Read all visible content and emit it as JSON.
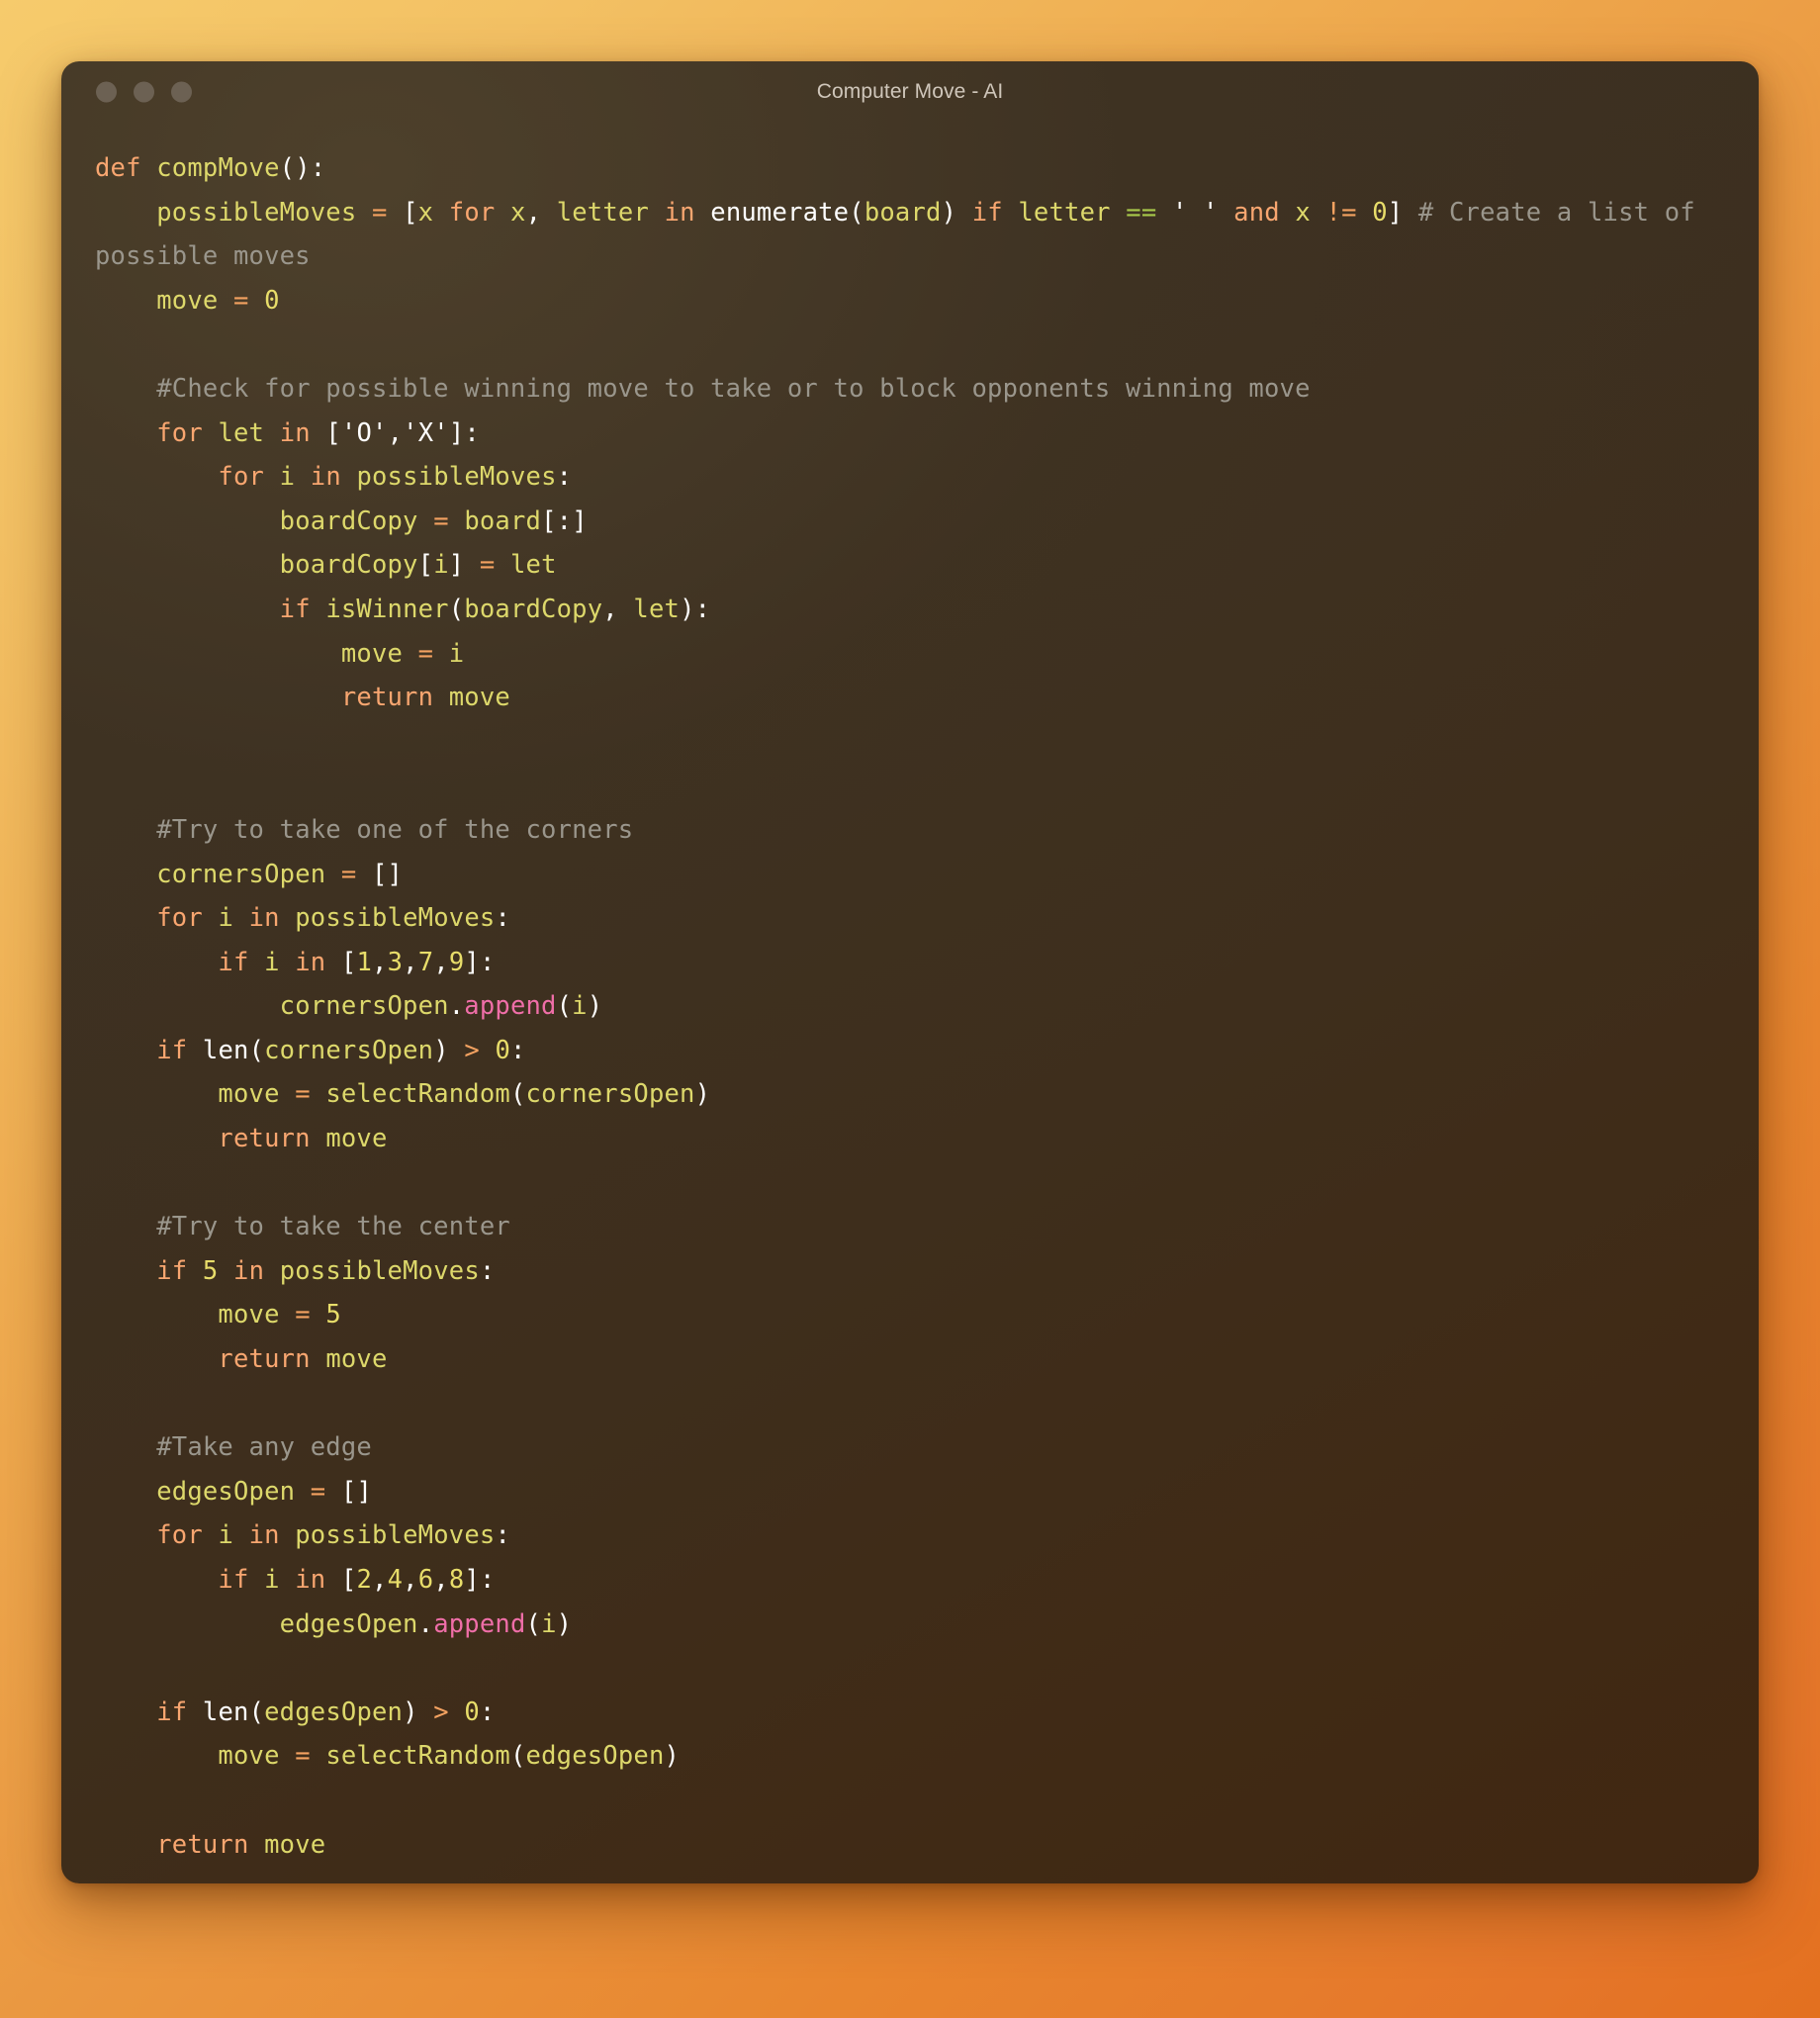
{
  "window": {
    "title": "Computer Move - AI",
    "traffic_lights": [
      {
        "name": "close",
        "color": "#6c6153"
      },
      {
        "name": "minimize",
        "color": "#6c6153"
      },
      {
        "name": "maximize",
        "color": "#6c6153"
      }
    ]
  },
  "theme": {
    "background_gradient_start": "#f6cb6c",
    "background_gradient_end": "#e3701f",
    "panel_background": "#3c3122",
    "text_default": "#e9e1d2",
    "keyword": "#f8a670",
    "identifier": "#ddd86b",
    "number": "#e8dd6a",
    "operator": "#f4a261",
    "comparison": "#a8c94a",
    "punctuation": "#ffffff",
    "method": "#ef6ea8",
    "comment": "#9a968c",
    "title_text": "#cfc6ba"
  },
  "code": {
    "language": "python",
    "plain_text": "def compMove():\n    possibleMoves = [x for x, letter in enumerate(board) if letter == ' ' and x != 0] # Create a list of possible moves\n    move = 0\n\n    #Check for possible winning move to take or to block opponents winning move\n    for let in ['O','X']:\n        for i in possibleMoves:\n            boardCopy = board[:]\n            boardCopy[i] = let\n            if isWinner(boardCopy, let):\n                move = i\n                return move\n\n\n    #Try to take one of the corners\n    cornersOpen = []\n    for i in possibleMoves:\n        if i in [1,3,7,9]:\n            cornersOpen.append(i)\n    if len(cornersOpen) > 0:\n        move = selectRandom(cornersOpen)\n        return move\n\n    #Try to take the center\n    if 5 in possibleMoves:\n        move = 5\n        return move\n\n    #Take any edge\n    edgesOpen = []\n    for i in possibleMoves:\n        if i in [2,4,6,8]:\n            edgesOpen.append(i)\n\n    if len(edgesOpen) > 0:\n        move = selectRandom(edgesOpen)\n\n    return move",
    "lines": [
      "def compMove():",
      "    possibleMoves = [x for x, letter in enumerate(board) if letter == ' ' and x != 0] # Create a list of possible moves",
      "    move = 0",
      "",
      "    #Check for possible winning move to take or to block opponents winning move",
      "    for let in ['O','X']:",
      "        for i in possibleMoves:",
      "            boardCopy = board[:]",
      "            boardCopy[i] = let",
      "            if isWinner(boardCopy, let):",
      "                move = i",
      "                return move",
      "",
      "",
      "    #Try to take one of the corners",
      "    cornersOpen = []",
      "    for i in possibleMoves:",
      "        if i in [1,3,7,9]:",
      "            cornersOpen.append(i)",
      "    if len(cornersOpen) > 0:",
      "        move = selectRandom(cornersOpen)",
      "        return move",
      "",
      "    #Try to take the center",
      "    if 5 in possibleMoves:",
      "        move = 5",
      "        return move",
      "",
      "    #Take any edge",
      "    edgesOpen = []",
      "    for i in possibleMoves:",
      "        if i in [2,4,6,8]:",
      "            edgesOpen.append(i)",
      "",
      "    if len(edgesOpen) > 0:",
      "        move = selectRandom(edgesOpen)",
      "",
      "    return move"
    ],
    "comments": [
      "# Create a list of possible moves",
      "#Check for possible winning move to take or to block opponents winning move",
      "#Try to take one of the corners",
      "#Try to take the center",
      "#Take any edge"
    ],
    "function_name": "compMove",
    "variables": [
      "possibleMoves",
      "move",
      "let",
      "i",
      "boardCopy",
      "board",
      "letter",
      "x",
      "cornersOpen",
      "edgesOpen"
    ],
    "called_functions": [
      "enumerate",
      "isWinner",
      "len",
      "selectRandom",
      "append"
    ],
    "numbers": [
      "0",
      "1",
      "3",
      "7",
      "9",
      "5",
      "2",
      "4",
      "6",
      "8"
    ],
    "string_literals": [
      "' '",
      "'O'",
      "'X'"
    ]
  }
}
